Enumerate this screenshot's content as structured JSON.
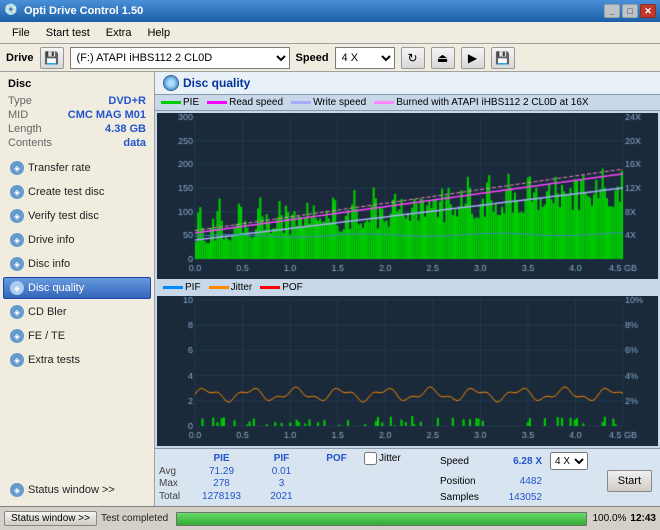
{
  "window": {
    "title": "Opti Drive Control 1.50",
    "icon": "💿"
  },
  "menu": {
    "items": [
      "File",
      "Start test",
      "Extra",
      "Help"
    ]
  },
  "drive": {
    "label": "Drive",
    "selected_drive": "(F:)  ATAPI iHBS112  2 CL0D",
    "speed_label": "Speed",
    "selected_speed": "4 X"
  },
  "disc": {
    "label": "Disc",
    "type_label": "Type",
    "type_value": "DVD+R",
    "mid_label": "MID",
    "mid_value": "CMC MAG M01",
    "length_label": "Length",
    "length_value": "4.38 GB",
    "contents_label": "Contents",
    "contents_value": "data"
  },
  "sidebar": {
    "buttons": [
      {
        "id": "transfer-rate",
        "label": "Transfer rate",
        "active": false
      },
      {
        "id": "create-test-disc",
        "label": "Create test disc",
        "active": false
      },
      {
        "id": "verify-test-disc",
        "label": "Verify test disc",
        "active": false
      },
      {
        "id": "drive-info",
        "label": "Drive info",
        "active": false
      },
      {
        "id": "disc-info",
        "label": "Disc info",
        "active": false
      },
      {
        "id": "disc-quality",
        "label": "Disc quality",
        "active": true
      },
      {
        "id": "cd-bler",
        "label": "CD Bler",
        "active": false
      },
      {
        "id": "fe-te",
        "label": "FE / TE",
        "active": false
      },
      {
        "id": "extra-tests",
        "label": "Extra tests",
        "active": false
      }
    ]
  },
  "chart": {
    "title": "Disc quality",
    "legend": {
      "pie_label": "PIE",
      "pie_color": "#00dd00",
      "read_speed_label": "Read speed",
      "read_speed_color": "#ff00ff",
      "write_speed_label": "Write speed",
      "write_speed_color": "#aaaaff",
      "burned_label": "Burned with ATAPI iHBS112  2 CL0D at 16X",
      "burned_color": "#ff88ff",
      "pif_label": "PIF",
      "pif_color": "#0088ff",
      "jitter_label": "Jitter",
      "jitter_color": "#ff8800",
      "pof_label": "POF",
      "pof_color": "#ff0000"
    },
    "top_yaxis": {
      "max": 300,
      "labels": [
        "300",
        "250",
        "200",
        "150",
        "100",
        "50",
        "0"
      ],
      "right_labels": [
        "24X",
        "20X",
        "16X",
        "12X",
        "8X",
        "4X"
      ]
    },
    "bottom_yaxis": {
      "max": 10,
      "labels": [
        "10",
        "8",
        "6",
        "4",
        "2",
        "0"
      ],
      "right_labels": [
        "10%",
        "8%",
        "6%",
        "4%",
        "2%"
      ]
    },
    "xaxis_max": 4.5,
    "xaxis_labels": [
      "0.0",
      "0.5",
      "1.0",
      "1.5",
      "2.0",
      "2.5",
      "3.0",
      "3.5",
      "4.0",
      "4.5 GB"
    ]
  },
  "stats": {
    "columns": {
      "pie_header": "PIE",
      "pif_header": "PIF",
      "pof_header": "POF",
      "jitter_header": "Jitter"
    },
    "rows": {
      "avg_label": "Avg",
      "max_label": "Max",
      "total_label": "Total",
      "pie_avg": "71.29",
      "pie_max": "278",
      "pie_total": "1278193",
      "pif_avg": "0.01",
      "pif_max": "3",
      "pif_total": "2021",
      "pof_avg": "",
      "pof_max": "",
      "pof_total": ""
    },
    "right": {
      "speed_label": "Speed",
      "speed_value": "6.28 X",
      "speed_select": "4 X",
      "position_label": "Position",
      "position_value": "4482",
      "samples_label": "Samples",
      "samples_value": "143052"
    },
    "start_btn": "Start"
  },
  "statusbar": {
    "window_btn": "Status window >>",
    "progress_pct": 100,
    "progress_text": "100.0%",
    "status_text": "Test completed",
    "time": "12:43"
  },
  "colors": {
    "accent_blue": "#2255cc",
    "sidebar_active": "#3366bb",
    "chart_bg": "#1a2a3a",
    "grid_line": "#2a4a6a"
  }
}
